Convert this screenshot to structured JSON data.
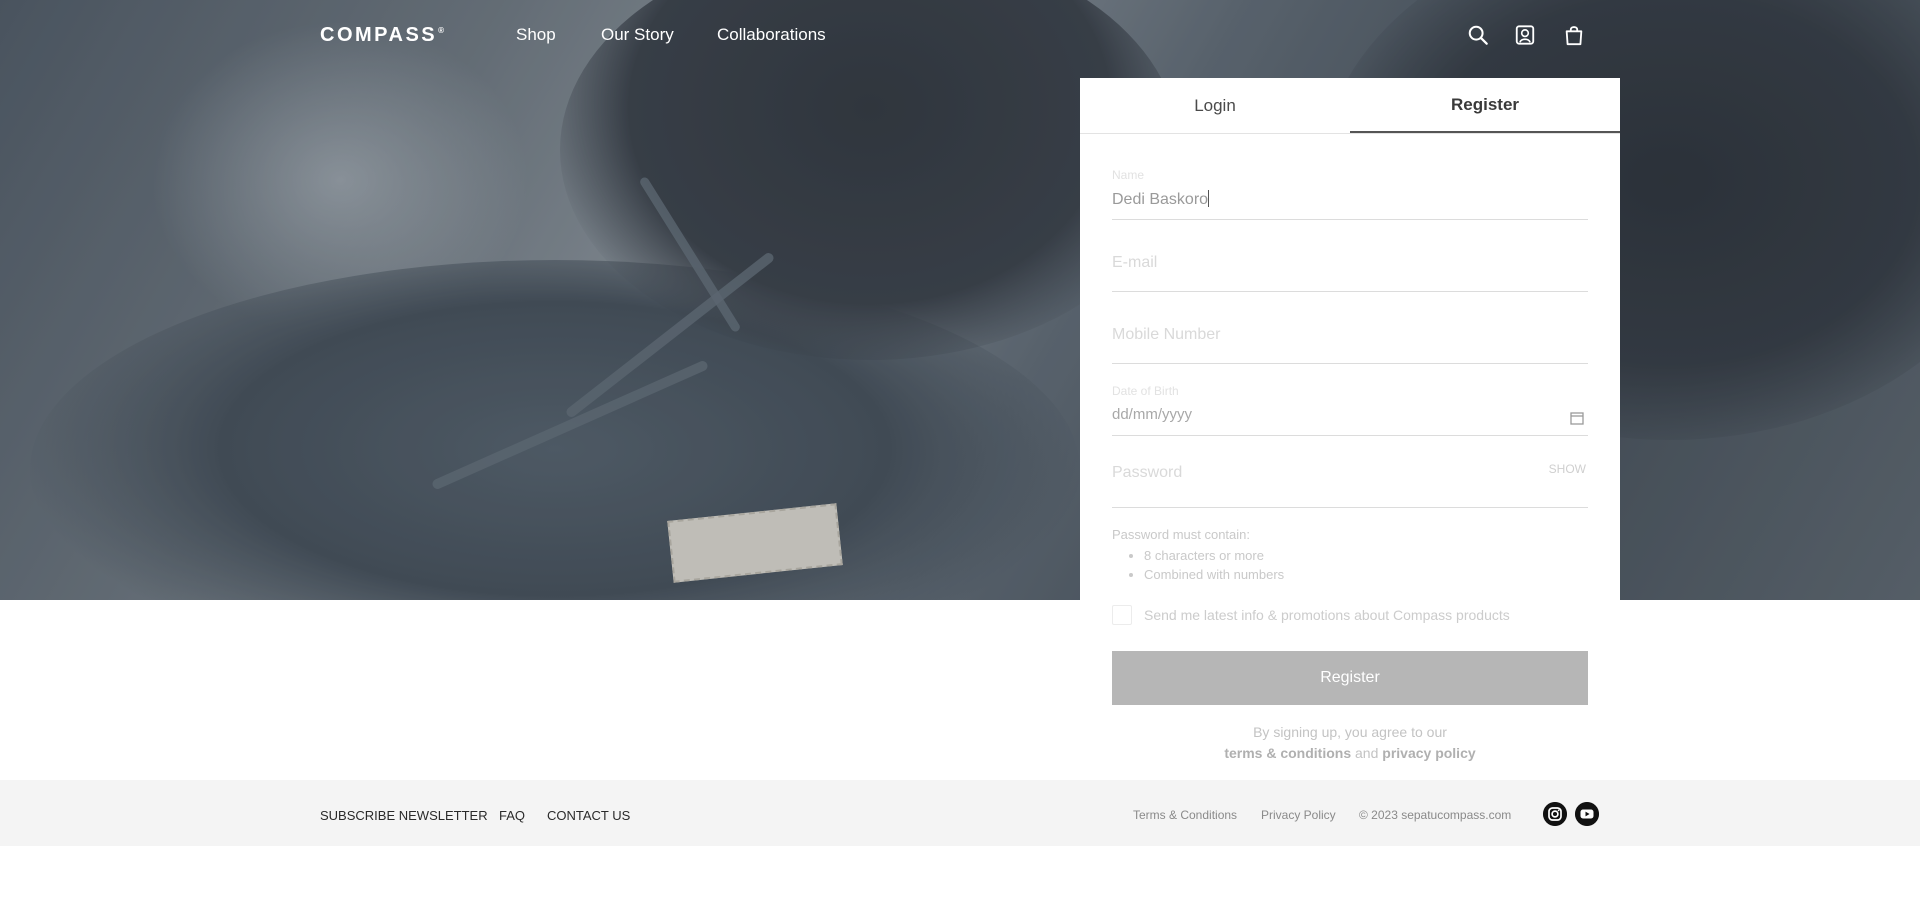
{
  "nav": {
    "logo": "COMPASS",
    "logo_mark": "®",
    "links": [
      "Shop",
      "Our Story",
      "Collaborations"
    ],
    "icons": [
      "search-icon",
      "account-icon",
      "cart-icon"
    ]
  },
  "auth": {
    "tabs": [
      {
        "label": "Login",
        "active": false
      },
      {
        "label": "Register",
        "active": true
      }
    ],
    "fields": {
      "name": {
        "label": "Name",
        "value": "Dedi Baskoro"
      },
      "email": {
        "placeholder": "E-mail"
      },
      "mobile": {
        "placeholder": "Mobile Number"
      },
      "dob": {
        "label": "Date of Birth",
        "value": "dd/mm/yyyy"
      },
      "password": {
        "placeholder": "Password",
        "show_label": "SHOW"
      }
    },
    "password_rules": {
      "title": "Password must contain:",
      "items": [
        "8 characters or more",
        "Combined with numbers"
      ]
    },
    "newsletter_label": "Send me latest info & promotions about Compass products",
    "register_button": "Register",
    "agree_text": "By signing up, you agree to our",
    "terms_link": "terms & conditions",
    "and_text": "and",
    "privacy_link": "privacy policy"
  },
  "footer": {
    "left_links": [
      "SUBSCRIBE NEWSLETTER",
      "FAQ",
      "CONTACT US"
    ],
    "terms": "Terms & Conditions",
    "privacy": "Privacy Policy",
    "copyright": "© 2023 sepatucompass.com",
    "social": [
      "instagram-icon",
      "youtube-icon"
    ]
  },
  "colors": {
    "register_button_bg": "#b6b6b6",
    "footer_bg": "#f4f4f4"
  }
}
